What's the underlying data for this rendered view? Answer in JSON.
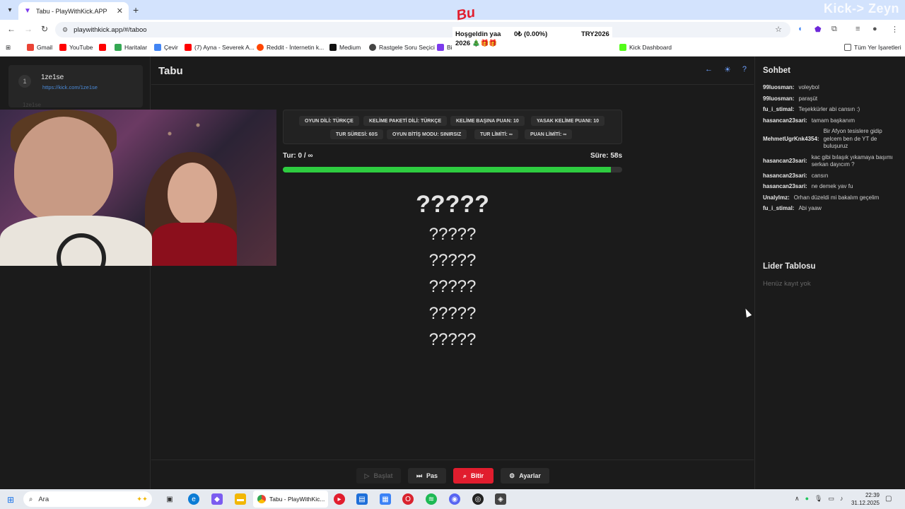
{
  "browser": {
    "tab_title": "Tabu - PlayWithKick.APP",
    "url": "playwithkick.app/#/taboo",
    "overlay_text": "Kick-> Zeyn",
    "bookmarks": [
      "Gmail",
      "YouTube",
      "",
      "Haritalar",
      "Çevir",
      "(7) Ayna - Severek A...",
      "Reddit - İnternetin k...",
      "Medium",
      "Rastgele Soru Seçici",
      "Bi",
      "Kick Dashboard"
    ],
    "all_bookmarks": "Tüm Yer İşaretleri"
  },
  "promo": {
    "line1": "Hoşgeldin yaa",
    "line2": "2026 🎄🎁🎁",
    "amount": "0₺ (0.00%)",
    "code": "TRY2026"
  },
  "player": {
    "number": "1",
    "name": "1ze1se",
    "link": "https://kick.com/1ze1se",
    "faded": "1ze1se"
  },
  "game": {
    "title": "Tabu",
    "rules": [
      "OYUN DİLİ: TÜRKÇE",
      "KELİME PAKETİ DİLİ: TÜRKÇE",
      "KELİME BAŞINA PUAN: 10",
      "YASAK KELİME PUANI: 10",
      "TUR SÜRESİ: 60S",
      "OYUN BİTİŞ MODU: SINIRSIZ",
      "TUR LİMİTİ: ∞",
      "PUAN LİMİTİ: ∞"
    ],
    "turn": "Tur: 0 / ∞",
    "time": "Süre: 58s",
    "progress": 0.966,
    "main_word": "?????",
    "taboo_words": [
      "?????",
      "?????",
      "?????",
      "?????",
      "?????"
    ],
    "buttons": {
      "start": "Başlat",
      "pass": "Pas",
      "end": "Bitir",
      "settings": "Ayarlar"
    }
  },
  "chat": {
    "title": "Sohbet",
    "messages": [
      {
        "user": "99luosman:",
        "text": "voleybol"
      },
      {
        "user": "99luosman:",
        "text": "paraşüt"
      },
      {
        "user": "fu_i_stimal:",
        "text": "Teşekkürler abi cansın :)"
      },
      {
        "user": "hasancan23sari:",
        "text": "tamam başkanım"
      },
      {
        "user": "MehmetUgrKnk4354:",
        "text": "Bir Afyon tesislere gidip gelcem ben de YT de buluşuruz"
      },
      {
        "user": "hasancan23sari:",
        "text": "kac gibi bılaşık yıkamaya başımı serkan dayıcım ?"
      },
      {
        "user": "hasancan23sari:",
        "text": "cansın"
      },
      {
        "user": "hasancan23sari:",
        "text": "ne demek yav fu"
      },
      {
        "user": "Unalylmz:",
        "text": "Orhan düzeldi mi bakalım geçelim"
      },
      {
        "user": "fu_i_stimal:",
        "text": "Abi yaaw"
      }
    ]
  },
  "leaderboard": {
    "title": "Lider Tablosu",
    "empty": "Henüz kayıt yok"
  },
  "taskbar": {
    "search": "Ara",
    "active_app": "Tabu - PlayWithKic...",
    "time": "22:39",
    "date": "31.12.2025"
  }
}
